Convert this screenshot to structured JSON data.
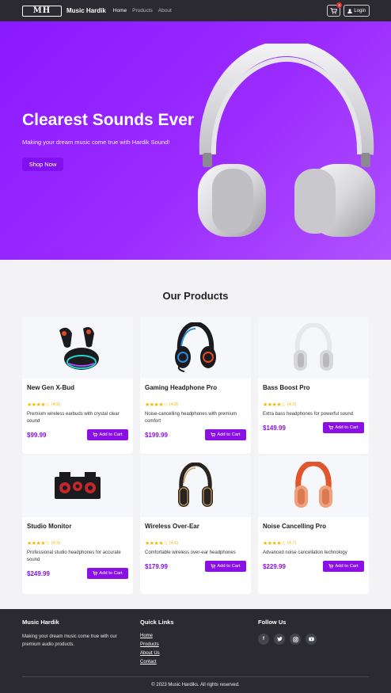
{
  "nav": {
    "logo_text": "MH",
    "brand": "Music Hardik",
    "links": [
      "Home",
      "Products",
      "About"
    ],
    "cart_count": "1",
    "login_label": "Login"
  },
  "hero": {
    "title": "Clearest Sounds Ever",
    "subtitle": "Making your dream music come true with Hardik Sound!",
    "cta": "Shop Now"
  },
  "products": {
    "section_title": "Our Products",
    "add_label": "Add to Cart",
    "items": [
      {
        "name": "New Gen X-Bud",
        "stars": "★★★★☆",
        "rating": "(4.5)",
        "desc": "Premium wireless earbuds with crystal clear sound",
        "price": "$99.99",
        "icon": "earbuds-icon"
      },
      {
        "name": "Gaming Headphone Pro",
        "stars": "★★★★☆",
        "rating": "(4.8)",
        "desc": "Noise-cancelling headphones with premium comfort",
        "price": "$199.99",
        "icon": "gaming-headphone-icon"
      },
      {
        "name": "Bass Boost Pro",
        "stars": "★★★★☆",
        "rating": "(4.3)",
        "desc": "Extra bass headphones for powerful sound",
        "price": "$149.99",
        "icon": "headphone-icon"
      },
      {
        "name": "Studio Monitor",
        "stars": "★★★★☆",
        "rating": "(4.9)",
        "desc": "Professional studio headphones for accurate sound",
        "price": "$249.99",
        "icon": "speaker-icon"
      },
      {
        "name": "Wireless Over-Ear",
        "stars": "★★★★☆",
        "rating": "(4.6)",
        "desc": "Comfortable wireless over-ear headphones",
        "price": "$179.99",
        "icon": "headphone-icon"
      },
      {
        "name": "Noise Cancelling Pro",
        "stars": "★★★★☆",
        "rating": "(4.7)",
        "desc": "Advanced noise cancellation technology",
        "price": "$229.99",
        "icon": "headphone-icon"
      }
    ]
  },
  "footer": {
    "about_title": "Music Hardik",
    "about_text": "Making your dream music come true with our premium audio products.",
    "links_title": "Quick Links",
    "links": [
      "Home",
      "Products",
      "About Us",
      "Contact"
    ],
    "follow_title": "Follow Us",
    "socials": [
      "facebook-icon",
      "twitter-icon",
      "instagram-icon",
      "youtube-icon"
    ],
    "copyright": "© 2023 Music Hardiks. All rights reserved."
  }
}
